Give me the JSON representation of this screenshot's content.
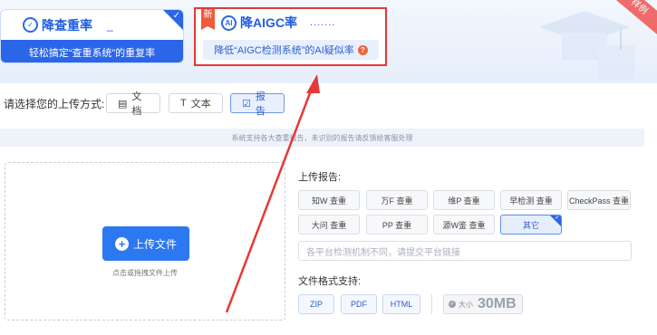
{
  "tabs": [
    {
      "title": "降查重率",
      "tail": "_",
      "subtitle": "轻松搞定“查重系统”的重复率",
      "icon": "check-logo-icon",
      "selected": true
    },
    {
      "title": "降AIGC率",
      "tail": ".......",
      "subtitle": "降低“AIGC检测系统”的AI疑似率",
      "icon": "ai-logo-icon",
      "badge": "新",
      "help": "?"
    }
  ],
  "ribbon": "样例",
  "upload_method": {
    "label": "请选择您的上传方式:",
    "options": [
      {
        "label": "文档",
        "icon": "document-icon"
      },
      {
        "label": "文本",
        "icon": "text-icon"
      },
      {
        "label": "报告",
        "icon": "report-icon",
        "active": true
      }
    ]
  },
  "notice": "系统支持各大查重报告，未识别的报告请反馈给客服处理",
  "dropzone": {
    "button": "上传文件",
    "hint": "点击或拖拽文件上传"
  },
  "report": {
    "title": "上传报告:",
    "options": [
      "知W 查重",
      "万F 查重",
      "维P 查重",
      "早检测 查重",
      "CheckPass 查重",
      "大问 查重",
      "PP 查重",
      "源W鉴 查重",
      "其它"
    ],
    "selected": "其它",
    "link_placeholder": "各平台检测机制不同，请提交平台链接"
  },
  "formats": {
    "title": "文件格式支持:",
    "items": [
      "ZIP",
      "PDF",
      "HTML"
    ],
    "size_label": "大小",
    "size_value": "30MB"
  },
  "colors": {
    "accent": "#2c66e8",
    "annotation": "#e53935"
  }
}
